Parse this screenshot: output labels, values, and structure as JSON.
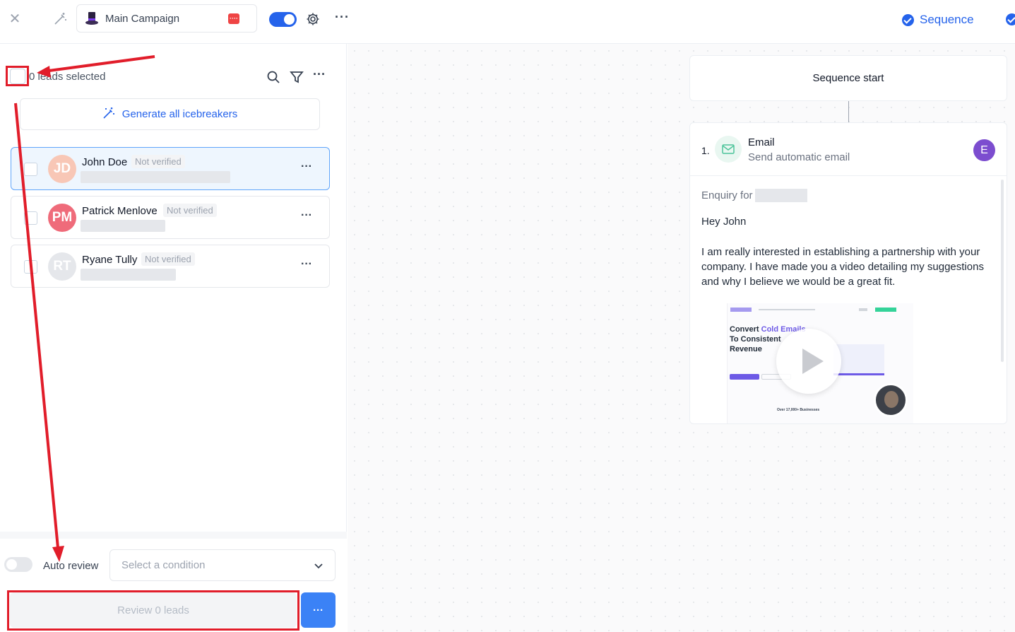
{
  "topbar": {
    "campaign_name": "Main Campaign",
    "campaign_badge": "····",
    "more_label": "···",
    "sequence_tab": "Sequence"
  },
  "left_panel": {
    "leads_selected": "0 leads selected",
    "more_label": "···",
    "generate_button": "Generate all icebreakers",
    "leads": [
      {
        "initials": "JD",
        "name": "John Doe",
        "status": "Not verified",
        "avatar_color": "#f8c7b6"
      },
      {
        "initials": "PM",
        "name": "Patrick Menlove",
        "status": "Not verified",
        "avatar_color": "#ef6b7a"
      },
      {
        "initials": "RT",
        "name": "Ryane Tully",
        "status": "Not verified",
        "avatar_color": "#e5e7eb"
      }
    ],
    "lead_more_label": "···",
    "auto_review_label": "Auto review",
    "condition_placeholder": "Select a condition",
    "review_button": "Review 0 leads",
    "review_more_label": "···"
  },
  "sequence": {
    "start_label": "Sequence start",
    "step_number": "1.",
    "step_title": "Email",
    "step_subtitle": "Send automatic email",
    "step_avatar": "E",
    "subject_prefix": "Enquiry for",
    "greeting": "Hey John",
    "body": "I am really interested in establishing a partnership with your company. I have made you a video detailing my suggestions and why I believe we would be a great fit.",
    "video": {
      "headline_1": "Convert ",
      "headline_highlight": "Cold Emails",
      "headline_2": "To Consistent",
      "headline_3": "Revenue",
      "footer": "Over 17,000+ Businesses"
    }
  },
  "colors": {
    "accent": "#2563eb",
    "annotation": "#e11d2a",
    "step_avatar": "#7c4dcf"
  }
}
